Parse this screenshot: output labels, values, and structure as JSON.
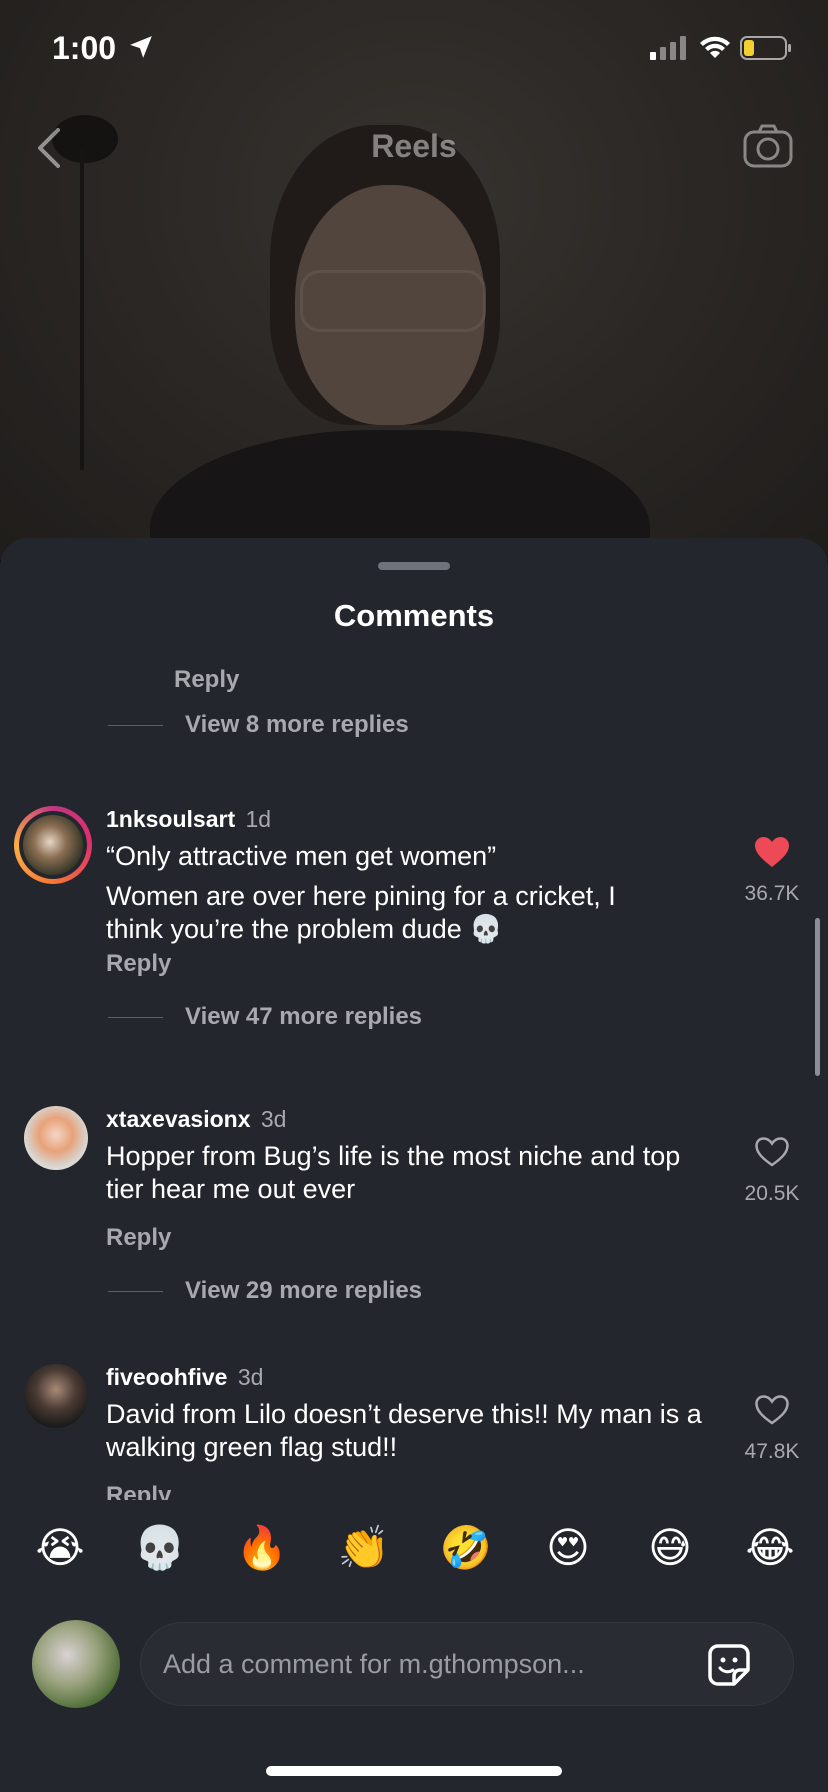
{
  "status": {
    "time": "1:00",
    "battery_color": "#f2d033"
  },
  "header": {
    "title": "Reels",
    "back_icon": "chevron-left-icon",
    "camera_icon": "camera-icon"
  },
  "sheet": {
    "title": "Comments",
    "top_reply": "Reply",
    "top_view_more": "View 8 more replies"
  },
  "comments": [
    {
      "user": "1nksoulsart",
      "age": "1d",
      "lines": [
        "“Only attractive men get women”",
        "Women are over here pining for a cricket, I think you’re the problem dude 💀"
      ],
      "liked": true,
      "likes": "36.7K",
      "reply": "Reply",
      "view_more": "View 47 more replies"
    },
    {
      "user": "xtaxevasionx",
      "age": "3d",
      "lines": [
        "Hopper from Bug’s life is the most niche and top tier hear me out ever"
      ],
      "liked": false,
      "likes": "20.5K",
      "reply": "Reply",
      "view_more": "View 29 more replies"
    },
    {
      "user": "fiveoohfive",
      "age": "3d",
      "lines": [
        "David from Lilo doesn’t deserve this!! My man is a walking green flag stud!!"
      ],
      "liked": false,
      "likes": "47.8K",
      "reply": "Reply"
    }
  ],
  "emojis": [
    "😭",
    "💀",
    "🔥",
    "👏",
    "🤣",
    "😍",
    "😅",
    "😂"
  ],
  "composer": {
    "placeholder": "Add a comment for m.gthompson...",
    "sticker_icon": "sticker-icon"
  },
  "colors": {
    "sheet_bg": "#24262d",
    "like_red": "#ed4956",
    "muted": "#a7a9ae"
  }
}
